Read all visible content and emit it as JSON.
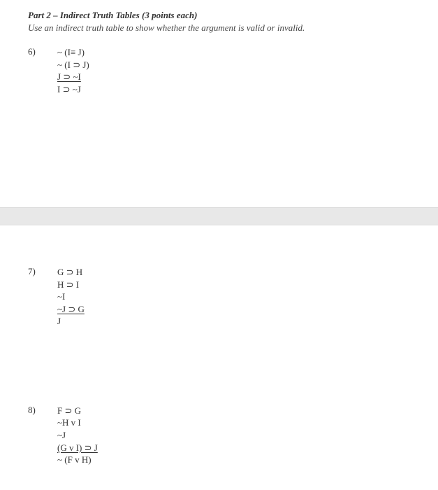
{
  "header": {
    "part_label": "Part 2 – Indirect Truth Tables (3 points each)",
    "instruction": "Use an indirect truth table to show whether the argument is valid or invalid."
  },
  "problems": {
    "p6": {
      "number": "6)",
      "lines": {
        "l1": "~ (I≡ J)",
        "l2": "~ (I ⊃ J)",
        "l3": "J ⊃ ~I",
        "l4": "I ⊃ ~J"
      }
    },
    "p7": {
      "number": "7)",
      "lines": {
        "l1": "G ⊃ H",
        "l2": "H ⊃ I",
        "l3": "~I",
        "l4": "~J ⊃ G",
        "l5": "J"
      }
    },
    "p8": {
      "number": "8)",
      "lines": {
        "l1": "F ⊃ G",
        "l2": "~H v I",
        "l3": "~J",
        "l4": "(G v I) ⊃ J",
        "l5": "~ (F v H)"
      }
    }
  }
}
